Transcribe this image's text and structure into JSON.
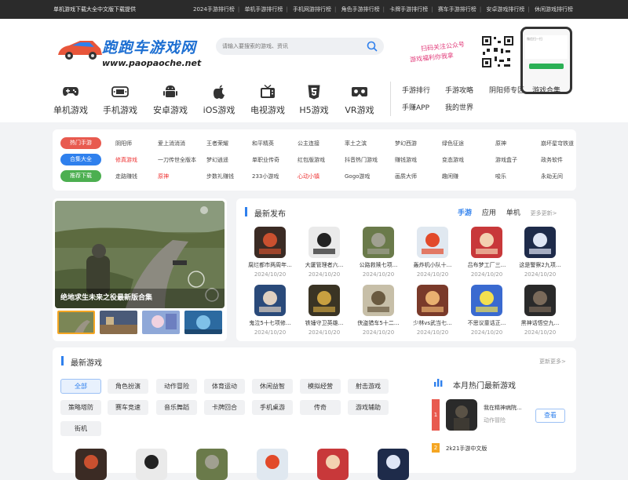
{
  "topbar": {
    "notice": "单机游戏下载大全中文版下载提供",
    "links": [
      "2024手游排行榜",
      "单机手游排行榜",
      "手机网游排行榜",
      "角色手游排行榜",
      "卡牌手游排行榜",
      "赛车手游排行榜",
      "安卓游戏排行榜",
      "休闲游戏排行榜"
    ]
  },
  "logo": {
    "name": "跑跑车游戏网",
    "url": "www.paopaoche.net"
  },
  "search": {
    "placeholder": "请输入要搜索的游戏、资讯"
  },
  "qr": {
    "line1": "扫码关注公众号",
    "line2": "游戏福利你我拿"
  },
  "phone": {
    "text": "微信扫一扫"
  },
  "nav": [
    "单机游戏",
    "手机游戏",
    "安卓游戏",
    "iOS游戏",
    "电视游戏",
    "H5游戏",
    "VR游戏"
  ],
  "nav_icons": [
    "gamepad-icon",
    "handheld-icon",
    "android-icon",
    "apple-icon",
    "tv-icon",
    "html5-icon",
    "vr-icon"
  ],
  "sublinks": {
    "row1": [
      "手游排行",
      "手游攻略",
      "阴阳师专区",
      "游戏合集"
    ],
    "row2": [
      "手赚APP",
      "我的世界"
    ]
  },
  "tag_rows": [
    {
      "label": "热门手游",
      "color": "#e85a4f",
      "items": [
        "阴阳师",
        "爱上消消消",
        "王者荣耀",
        "和平精英",
        "公主连接",
        "率土之滨",
        "梦幻西游",
        "绿色征途",
        "原神",
        "崩坏星穹铁道"
      ],
      "red": []
    },
    {
      "label": "合集大全",
      "color": "#2f80ed",
      "items": [
        "修真游戏",
        "一刀传世全版本",
        "梦幻逍遥",
        "单职业传奇",
        "红包版游戏",
        "抖音热门游戏",
        "赚钱游戏",
        "变态游戏",
        "游戏盒子",
        "政务软件"
      ],
      "red": [
        0
      ]
    },
    {
      "label": "推荐下载",
      "color": "#4caf50",
      "items": [
        "走路赚钱",
        "原神",
        "步数礼赚钱",
        "233小游戏",
        "心动小镇",
        "Gogo游戏",
        "画质大师",
        "趣闲赚",
        "唆乐",
        "永劫无间"
      ],
      "red": [
        1,
        4
      ]
    }
  ],
  "carousel": {
    "caption": "绝地求生未来之役最新版合集"
  },
  "latest": {
    "title": "最新发布",
    "tabs": [
      "手游",
      "应用",
      "单机"
    ],
    "more": "更多更新>",
    "games": [
      {
        "name": "腐烂都市两周年...",
        "date": "2024/10/20"
      },
      {
        "name": "大厦管理者六...",
        "date": "2024/10/20"
      },
      {
        "name": "公路救赎七项...",
        "date": "2024/10/20"
      },
      {
        "name": "轰炸机小队十...",
        "date": "2024/10/20"
      },
      {
        "name": "吕布梦工厂三...",
        "date": "2024/10/20"
      },
      {
        "name": "这是警察2九项...",
        "date": "2024/10/20"
      },
      {
        "name": "鬼泣5十七项修...",
        "date": "2024/10/20"
      },
      {
        "name": "铁锤守卫英雄...",
        "date": "2024/10/20"
      },
      {
        "name": "侠盗猎车5十二...",
        "date": "2024/10/20"
      },
      {
        "name": "少林vs武当七...",
        "date": "2024/10/20"
      },
      {
        "name": "不思议童话正...",
        "date": "2024/10/20"
      },
      {
        "name": "黑神话悟空九...",
        "date": "2024/10/20"
      }
    ]
  },
  "newgames": {
    "title": "最新游戏",
    "more": "更新更多>",
    "cats": [
      "全部",
      "角色扮演",
      "动作冒险",
      "体育运动",
      "休闲益智",
      "模拟经营",
      "射击游戏",
      "策略塔防",
      "赛车竞速",
      "音乐舞蹈",
      "卡牌回合",
      "手机桌游",
      "传奇",
      "游戏辅助",
      "街机"
    ]
  },
  "hot": {
    "title": "本月热门最新游戏",
    "first": {
      "rank": "1",
      "name": "我在精神病院...",
      "genre": "动作冒险",
      "button": "查看"
    },
    "second": {
      "rank": "2",
      "name": "2k21手游中文版"
    }
  }
}
